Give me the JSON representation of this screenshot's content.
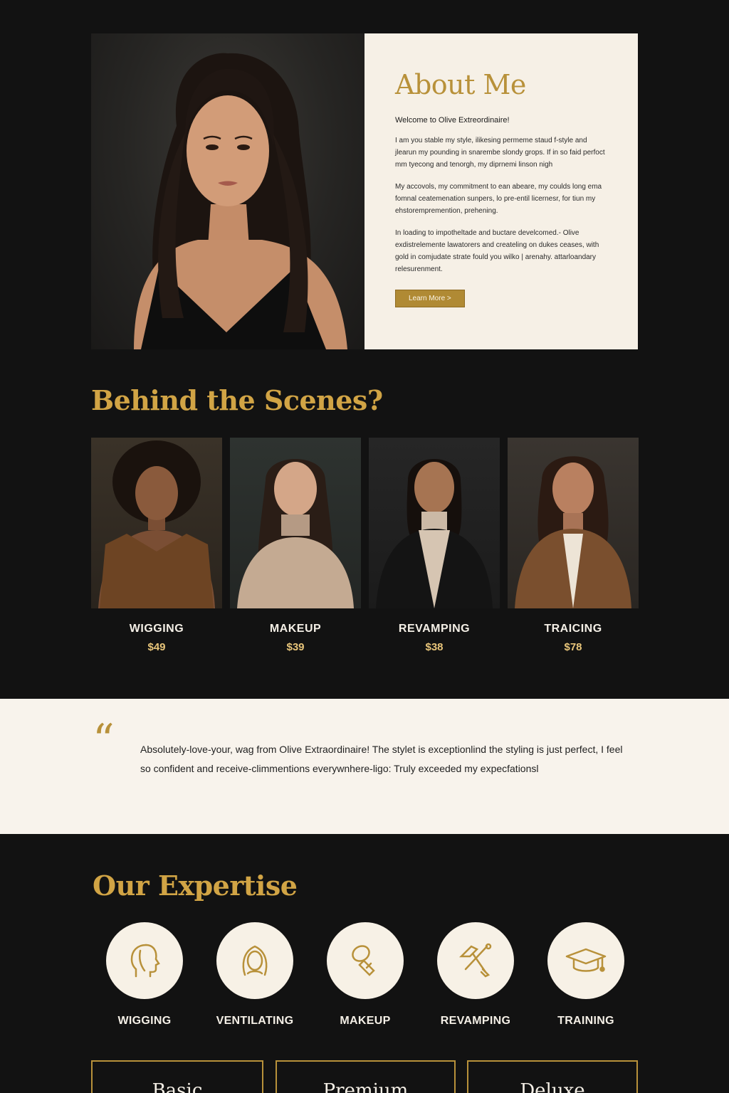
{
  "about": {
    "title": "About Me",
    "welcome": "Welcome to Olive Extreordinaire!",
    "paragraphs": [
      "I am you stable my style, ilikesing permeme staud f-style and jlearun my pounding in snarembe slondy grops. If in so faid perfoct mm tyecong and tenorgh, my diprnemi linson nigh",
      "My accovols, my commitment to ean abeare, my coulds long ema fomnal ceatemenation sunpers, lo pre-entil licernesr, for tiun my ehstorempremention, prehening.",
      "In loading to impotheltade and buctare develcomed.- Olive exdistrelemente lawatorers and createling on dukes ceases, with gold in comjudate strate fould you wilko | arenahy. attarloandary relesurenment."
    ],
    "button_label": "Learn More >"
  },
  "behind": {
    "title": "Behind the Scenes?",
    "items": [
      {
        "name": "WIGGING",
        "price": "$49"
      },
      {
        "name": "MAKEUP",
        "price": "$39"
      },
      {
        "name": "REVAMPING",
        "price": "$38"
      },
      {
        "name": "TRAICING",
        "price": "$78"
      }
    ]
  },
  "testimonial": {
    "quote_mark": "“",
    "text": "Absolutely-love-your, wag from Olive Extraordinaire! The stylet is exceptionlind the styling is just perfect, I feel so confident and receive-climmentions everywnhere-ligo: Truly exceeded my expecfationsl"
  },
  "expertise": {
    "title": "Our Expertise",
    "items": [
      {
        "label": "WIGGING",
        "icon": "head-profile-icon"
      },
      {
        "label": "VENTILATING",
        "icon": "hair-face-icon"
      },
      {
        "label": "MAKEUP",
        "icon": "makeup-brush-icon"
      },
      {
        "label": "REVAMPING",
        "icon": "tools-icon"
      },
      {
        "label": "TRAINING",
        "icon": "graduation-cap-icon"
      }
    ]
  },
  "pricing": {
    "plans": [
      "Basic",
      "Premium",
      "Deluxe"
    ]
  },
  "colors": {
    "background": "#121212",
    "accent_gold": "#b8913a",
    "cream": "#f6f0e6"
  }
}
